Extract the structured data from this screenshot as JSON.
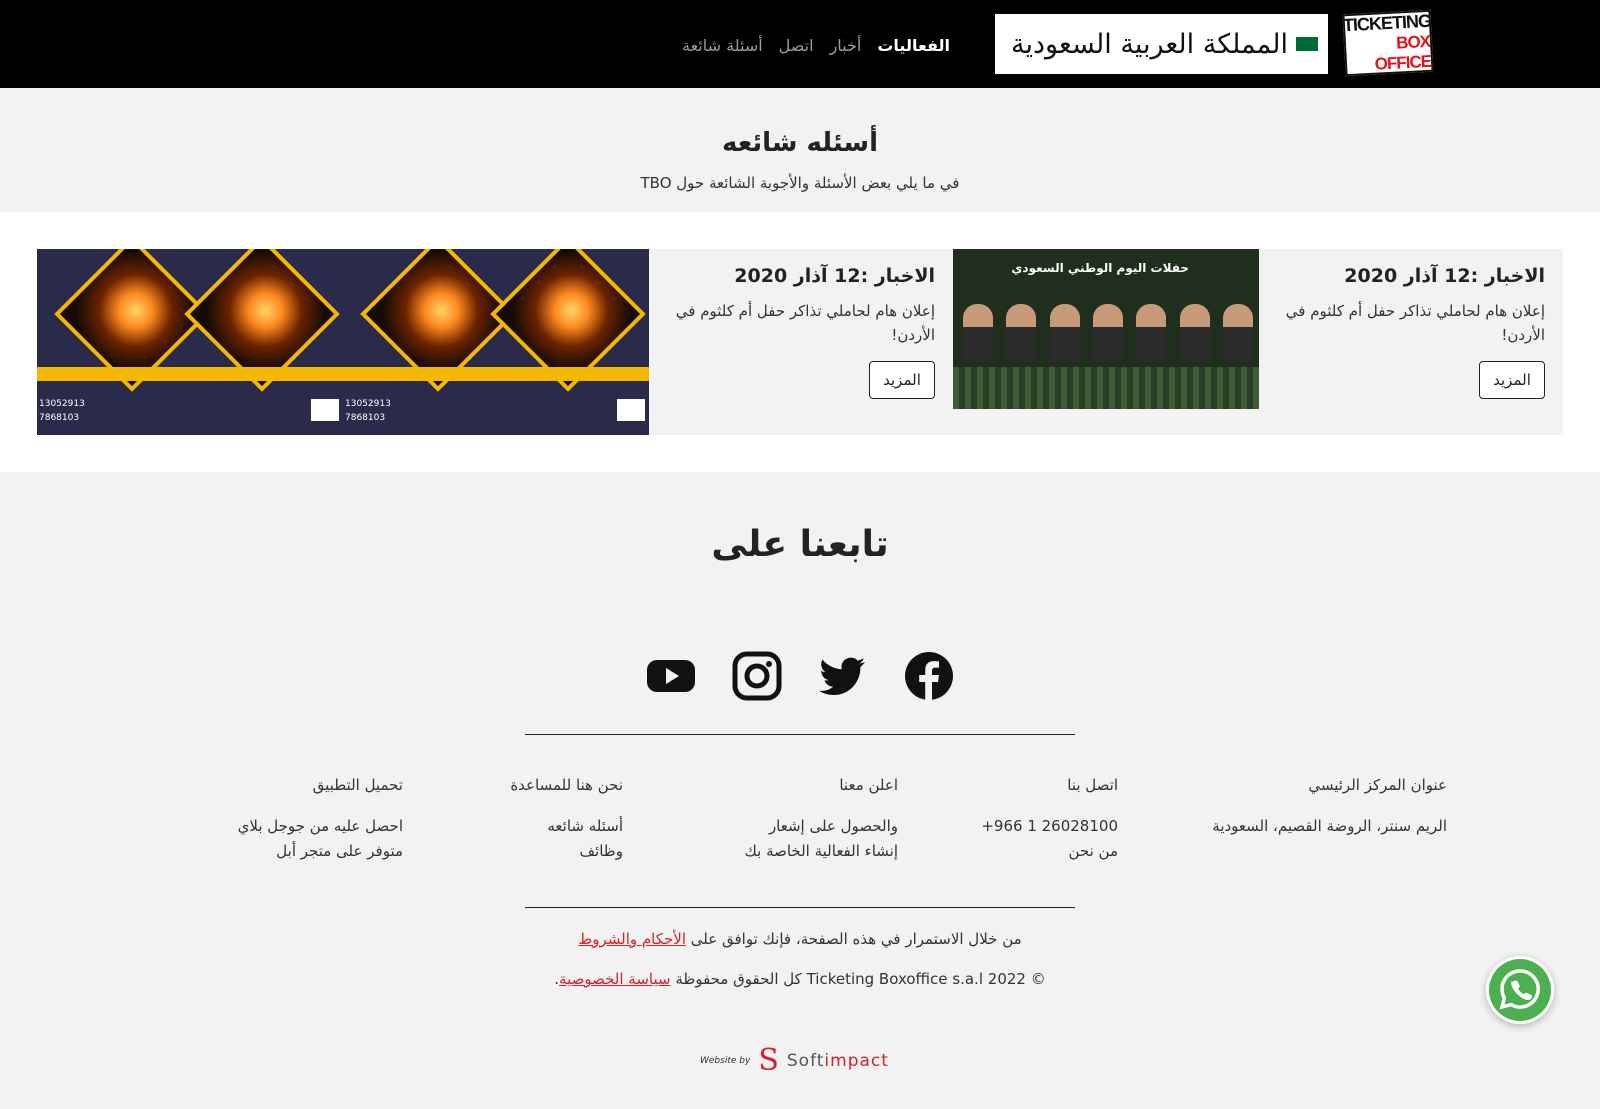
{
  "header": {
    "logo_line1": "TICKETING",
    "logo_line2": "BOX OFFICE",
    "country": "المملكة العربية السعودية",
    "nav": [
      "الفعاليات",
      "أخبار",
      "اتصل",
      "أسئلة شائعة"
    ],
    "active_nav": "الفعاليات"
  },
  "faq": {
    "title": "أسئله شائعه",
    "subtitle": "في ما يلي بعض الأسئلة والأجوبة الشائعة حول TBO"
  },
  "news": {
    "cards": [
      {
        "date": "الاخبار :12 آذار 2020",
        "text": "إعلان هام لحاملي تذاكر حفل أم كلثوم في الأردن!",
        "button": "المزيد",
        "image": "fire-show-poster",
        "poster_title": "",
        "phone_1": "13052913",
        "phone_2": "7868103"
      },
      {
        "date": "الاخبار :12 آذار 2020",
        "text": "إعلان هام لحاملي تذاكر حفل أم كلثوم في الأردن!",
        "button": "المزيد",
        "image": "national-day-poster",
        "poster_title": "حفلات اليوم الوطني السعودي"
      }
    ],
    "extra_image": "fire-show-poster",
    "extra_phone_1": "13052913",
    "extra_phone_2": "7868103"
  },
  "follow": {
    "title": "تابعنا على",
    "icons": [
      "youtube-icon",
      "instagram-icon",
      "twitter-icon",
      "facebook-icon"
    ]
  },
  "footer": {
    "address": {
      "heading": "عنوان المركز الرئيسي",
      "value": "الريم سنتر، الروضة القصيم، السعودية"
    },
    "contact": {
      "heading": "اتصل بنا",
      "phone": "+966 1 26028100",
      "about": "من نحن"
    },
    "advertise": {
      "heading": "اعلن معنا",
      "item1": "والحصول على إشعار",
      "item2": "إنشاء الفعالية الخاصة بك"
    },
    "help": {
      "heading": "نحن هنا للمساعدة",
      "item1": "أسئله شائعه",
      "item2": "وظائف"
    },
    "app": {
      "heading": "تحميل التطبيق",
      "item1": "احصل عليه من جوجل بلاي",
      "item2": "متوفر على متجر أبل"
    },
    "terms_text": "من خلال الاستمرار في هذه الصفحة، فإنك توافق على",
    "terms_link": "الأحكام والشروط",
    "copyright": "© 2022 Ticketing Boxoffice s.a.l كل الحقوق محفوظة",
    "privacy_link": "سياسة الخصوصية",
    "privacy_suffix": ".",
    "credit_by": "Website by",
    "credit_soft": "Soft",
    "credit_impact": "impact"
  },
  "colors": {
    "header_bg": "#000000",
    "accent_red": "#d2232a",
    "whatsapp_green": "#4caf50"
  }
}
